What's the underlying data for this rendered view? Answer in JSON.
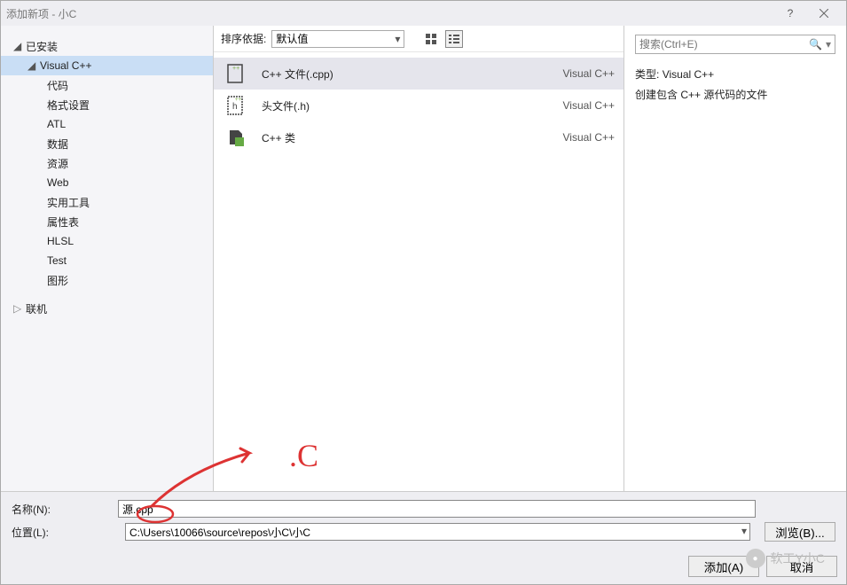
{
  "window": {
    "title": "添加新项 - 小C"
  },
  "sidebar": {
    "installed": "已安装",
    "vcpp": "Visual C++",
    "items": [
      "代码",
      "格式设置",
      "ATL",
      "数据",
      "资源",
      "Web",
      "实用工具",
      "属性表",
      "HLSL",
      "Test",
      "图形"
    ],
    "online": "联机"
  },
  "center": {
    "sort_label": "排序依据:",
    "sort_value": "默认值",
    "templates": [
      {
        "name": "C++ 文件(.cpp)",
        "lang": "Visual C++",
        "selected": true,
        "icon": "cpp-file"
      },
      {
        "name": "头文件(.h)",
        "lang": "Visual C++",
        "selected": false,
        "icon": "h-file"
      },
      {
        "name": "C++ 类",
        "lang": "Visual C++",
        "selected": false,
        "icon": "cpp-class"
      }
    ]
  },
  "right": {
    "search_placeholder": "搜索(Ctrl+E)",
    "type_label": "类型:",
    "type_value": "Visual C++",
    "description": "创建包含 C++ 源代码的文件"
  },
  "form": {
    "name_label": "名称(N):",
    "name_value": "源.cpp",
    "location_label": "位置(L):",
    "location_value": "C:\\Users\\10066\\source\\repos\\小C\\小C",
    "browse": "浏览(B)..."
  },
  "footer": {
    "add": "添加(A)",
    "cancel": "取消"
  },
  "annotation": {
    "text": ".C"
  },
  "watermark": "软工Y小C"
}
